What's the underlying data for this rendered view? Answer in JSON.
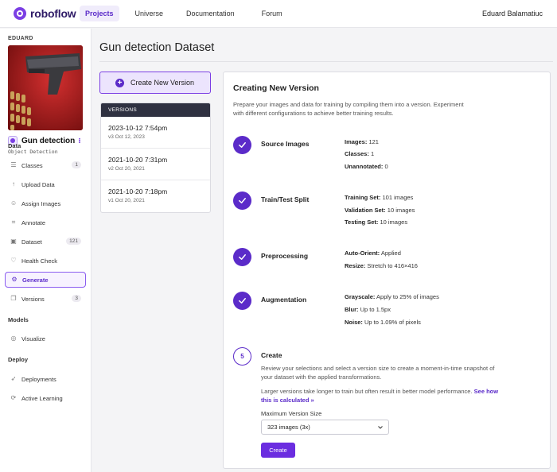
{
  "brand": {
    "name": "roboflow",
    "accent": "#5b2bc9"
  },
  "nav": {
    "projects": "Projects",
    "universe": "Universe",
    "documentation": "Documentation",
    "forum": "Forum",
    "user": "Eduard Balamatiuc"
  },
  "sidebar": {
    "owner": "EDUARD",
    "project_name": "Gun detection",
    "project_type": "Object Detection",
    "sections": {
      "data": "Data",
      "models": "Models",
      "deploy": "Deploy"
    },
    "items": {
      "classes": {
        "label": "Classes",
        "badge": "1"
      },
      "upload": {
        "label": "Upload Data"
      },
      "assign": {
        "label": "Assign Images"
      },
      "annotate": {
        "label": "Annotate"
      },
      "dataset": {
        "label": "Dataset",
        "badge": "121"
      },
      "health": {
        "label": "Health Check"
      },
      "generate": {
        "label": "Generate"
      },
      "versions": {
        "label": "Versions",
        "badge": "3"
      },
      "visualize": {
        "label": "Visualize"
      },
      "deployments": {
        "label": "Deployments"
      },
      "active_learning": {
        "label": "Active Learning"
      }
    }
  },
  "main": {
    "title": "Gun detection Dataset",
    "create_version_button": "Create New Version",
    "versions_header": "VERSIONS",
    "versions": [
      {
        "date": "2023-10-12 7:54pm",
        "sub": "v3 Oct 12, 2023"
      },
      {
        "date": "2021-10-20 7:31pm",
        "sub": "v2 Oct 20, 2021"
      },
      {
        "date": "2021-10-20 7:18pm",
        "sub": "v1 Oct 20, 2021"
      }
    ]
  },
  "card": {
    "title": "Creating New Version",
    "desc": "Prepare your images and data for training by compiling them into a version. Experiment with different configurations to achieve better training results.",
    "source": {
      "label": "Source Images",
      "images_k": "Images:",
      "images_v": "121",
      "classes_k": "Classes:",
      "classes_v": "1",
      "unannotated_k": "Unannotated:",
      "unannotated_v": "0"
    },
    "split": {
      "label": "Train/Test Split",
      "train_k": "Training Set:",
      "train_v": "101 images",
      "valid_k": "Validation Set:",
      "valid_v": "10 images",
      "test_k": "Testing Set:",
      "test_v": "10 images"
    },
    "preprocessing": {
      "label": "Preprocessing",
      "orient_k": "Auto-Orient:",
      "orient_v": "Applied",
      "resize_k": "Resize:",
      "resize_v": "Stretch to 416×416"
    },
    "augmentation": {
      "label": "Augmentation",
      "gray_k": "Grayscale:",
      "gray_v": "Apply to 25% of images",
      "blur_k": "Blur:",
      "blur_v": "Up to 1.5px",
      "noise_k": "Noise:",
      "noise_v": "Up to 1.09% of pixels"
    },
    "create": {
      "number": "5",
      "label": "Create",
      "desc": "Review your selections and select a version size to create a moment-in-time snapshot of your dataset with the applied transformations.",
      "desc2": "Larger versions take longer to train but often result in better model performance.",
      "link": "See how this is calculated »",
      "max_label": "Maximum Version Size",
      "select_value": "323 images (3x)",
      "button": "Create"
    }
  }
}
